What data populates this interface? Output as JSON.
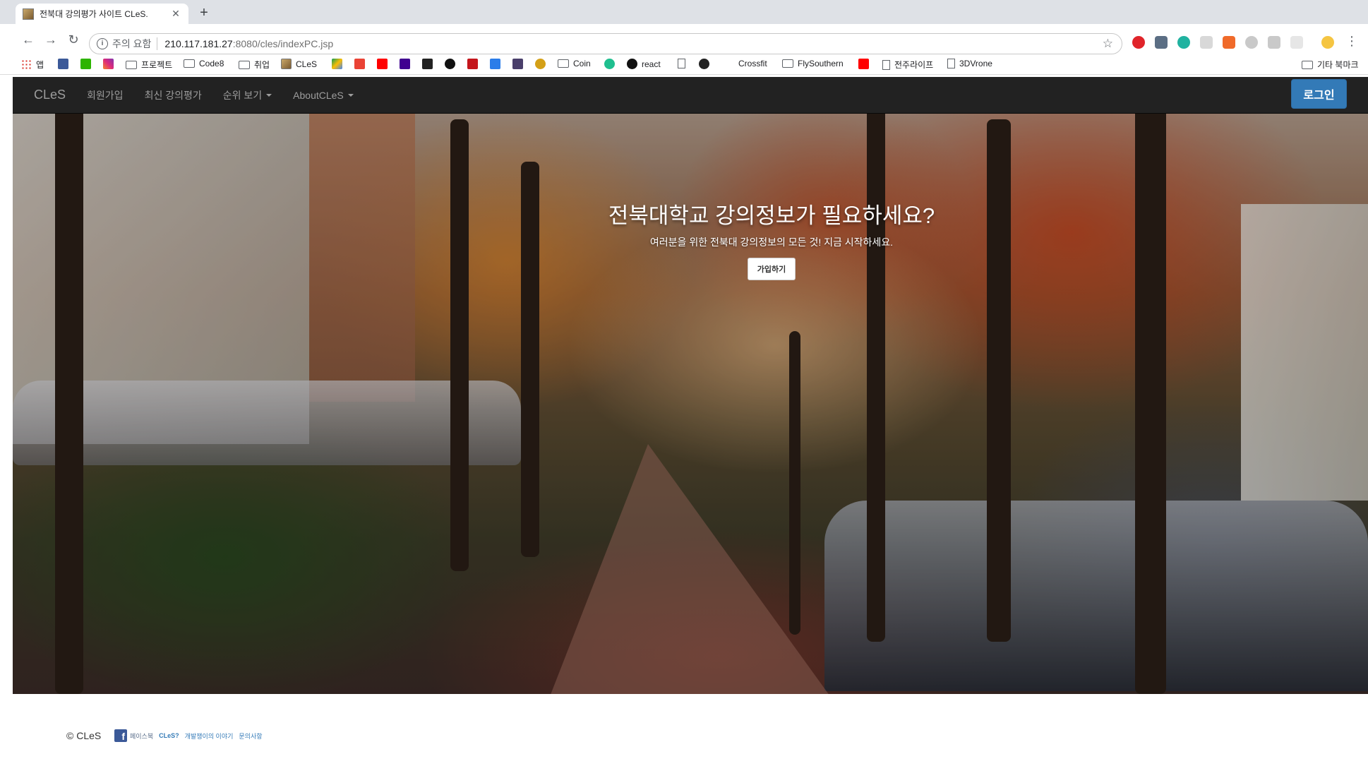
{
  "browser": {
    "tab_title": "전북대 강의평가 사이트 CLeS.",
    "new_tab": "+",
    "security_label": "주의 요함",
    "url_host": "210.117.181.27",
    "url_rest": ":8080/cles/indexPC.jsp",
    "bookmarks": [
      {
        "label": "앱",
        "kind": "apps"
      },
      {
        "label": "",
        "kind": "facebook"
      },
      {
        "label": "",
        "kind": "naver"
      },
      {
        "label": "",
        "kind": "instagram"
      },
      {
        "label": "프로젝트",
        "kind": "folder"
      },
      {
        "label": "Code8",
        "kind": "folder"
      },
      {
        "label": "취업",
        "kind": "folder"
      },
      {
        "label": "CLeS",
        "kind": "site"
      },
      {
        "label": "Coin",
        "kind": "folder"
      },
      {
        "label": "react",
        "kind": "github"
      },
      {
        "label": "Crossfit",
        "kind": "site"
      },
      {
        "label": "FlySouthern",
        "kind": "folder"
      },
      {
        "label": "전주라이프",
        "kind": "page"
      },
      {
        "label": "3DVrone",
        "kind": "page"
      },
      {
        "label": "기타 북마크",
        "kind": "folder"
      }
    ]
  },
  "navbar": {
    "brand": "CLeS",
    "links": [
      "회원가입",
      "최신 강의평가",
      "순위 보기",
      "AboutCLeS"
    ],
    "login": "로그인"
  },
  "hero": {
    "title": "전북대학교 강의정보가 필요하세요?",
    "subtitle": "여러분을 위한 전북대 강의정보의 모든 것! 지금 시작하세요.",
    "cta": "가입하기"
  },
  "footer": {
    "copyright": "© CLeS",
    "links": [
      "페이스북",
      "CLeS?",
      "개발쟁이의 이야기",
      "문의사항"
    ]
  },
  "colors": {
    "navbar_bg": "#222222",
    "login_bg": "#337ab7",
    "link": "#337ab7"
  }
}
